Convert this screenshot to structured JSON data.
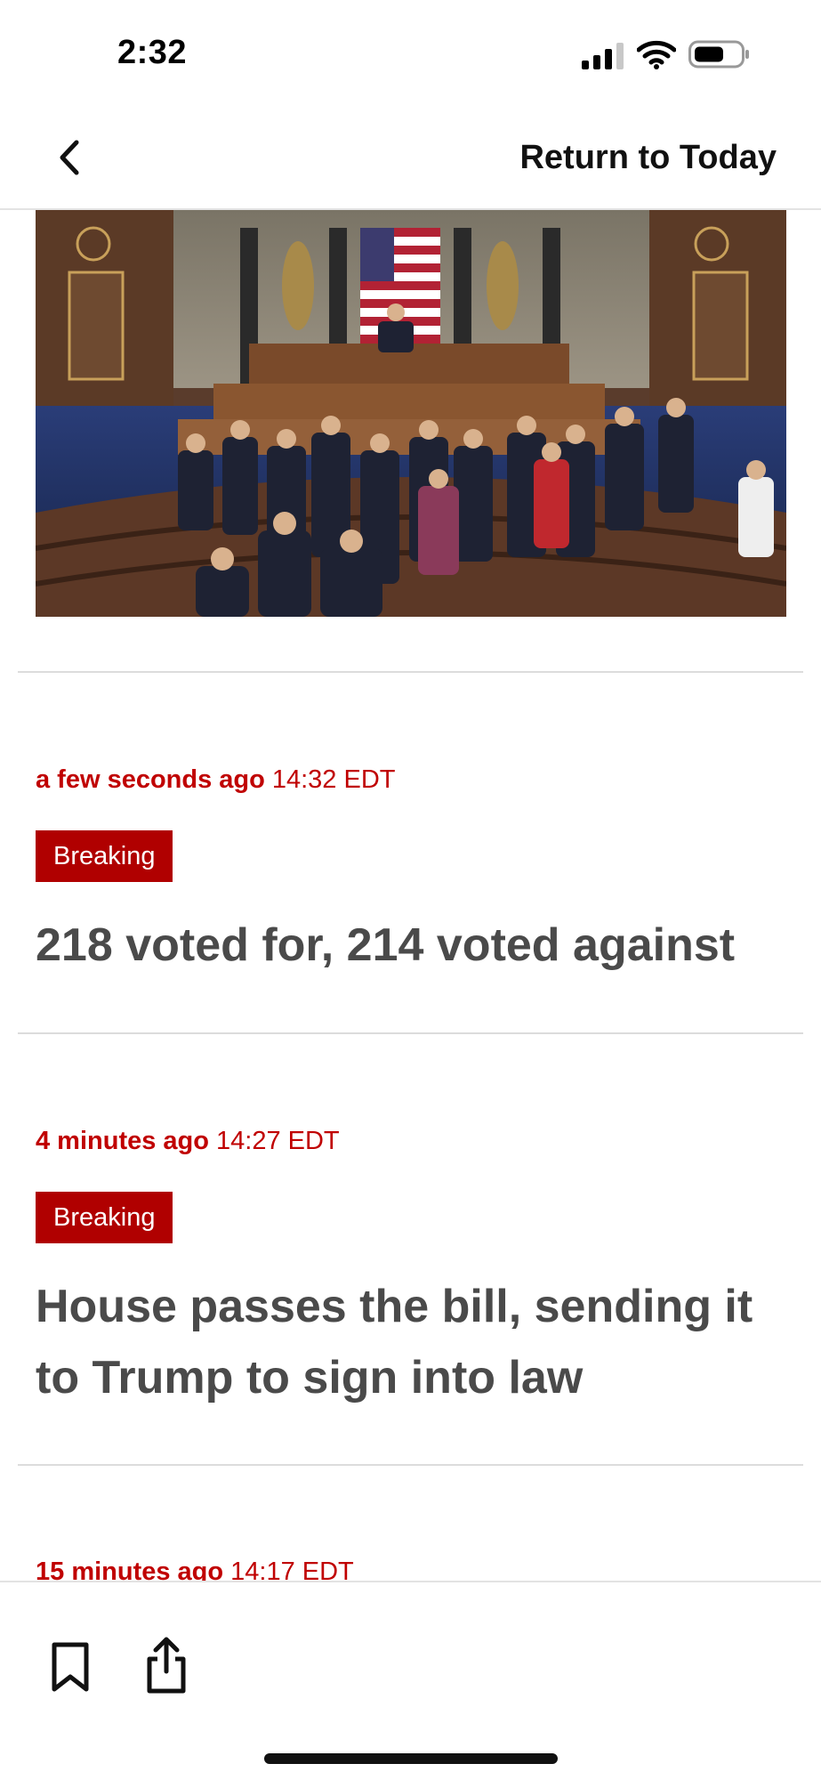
{
  "status_bar": {
    "time": "2:32",
    "icons": [
      "cellular-signal-icon",
      "wifi-icon",
      "battery-icon"
    ]
  },
  "nav": {
    "back_icon": "chevron-left-icon",
    "return_label": "Return to Today"
  },
  "hero_image": {
    "description": "House chamber floor with members gathered"
  },
  "posts": [
    {
      "ago": "a few seconds ago",
      "time": "14:32 EDT",
      "badge": "Breaking",
      "headline": "218 voted for, 214 voted against"
    },
    {
      "ago": "4 minutes ago",
      "time": "14:27 EDT",
      "badge": "Breaking",
      "headline": "House passes the bill, sending it to Trump to sign into law"
    },
    {
      "ago": "15 minutes ago",
      "time": "14:17 EDT"
    }
  ],
  "bottom_bar": {
    "icons": [
      "bookmark-icon",
      "share-icon"
    ]
  },
  "colors": {
    "accent_red": "#c00000",
    "badge_red": "#b00000",
    "headline_gray": "#4a4a4a"
  }
}
